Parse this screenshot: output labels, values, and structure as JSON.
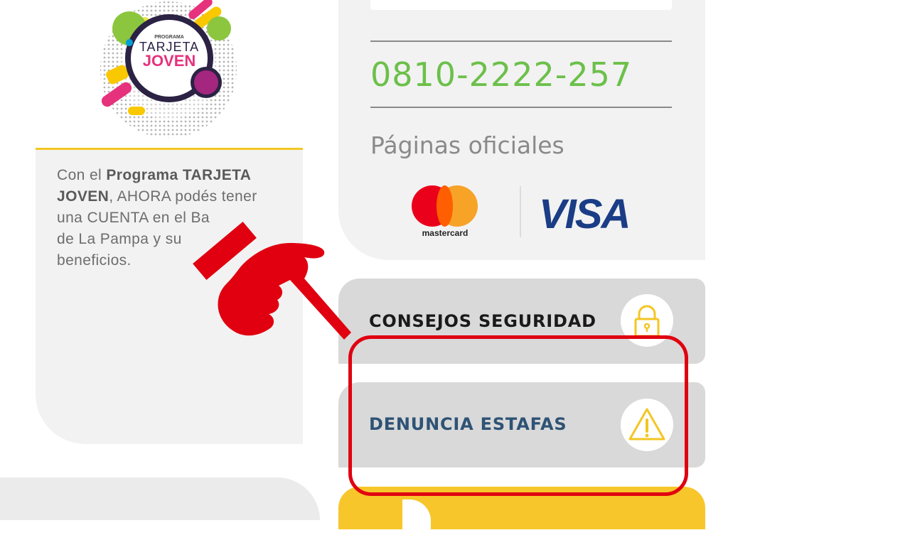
{
  "left": {
    "logo": {
      "top_text": "PROGRAMA",
      "line1": "TARJETA",
      "line2": "JOVEN"
    },
    "promo": {
      "prefix": "Con el ",
      "bold": "Programa TARJETA JOVEN",
      "rest1": ", AHORA podés tener",
      "rest2": "una CUENTA en el Ba",
      "rest3": "de La Pampa y su",
      "rest4": "beneficios."
    }
  },
  "right": {
    "phone": "0810-2222-257",
    "pages_title": "Páginas oficiales",
    "payment_logos": {
      "mastercard": "mastercard",
      "visa": "VISA"
    }
  },
  "buttons": {
    "security": {
      "label": "CONSEJOS SEGURIDAD",
      "icon": "lock-icon"
    },
    "fraud": {
      "label": "DENUNCIA ESTAFAS",
      "icon": "warning-icon"
    }
  },
  "colors": {
    "accent_yellow": "#f3c623",
    "phone_green": "#6cc04a",
    "highlight_red": "#e00010",
    "fraud_label_blue": "#2e5375",
    "security_label": "#1a1a1a"
  }
}
